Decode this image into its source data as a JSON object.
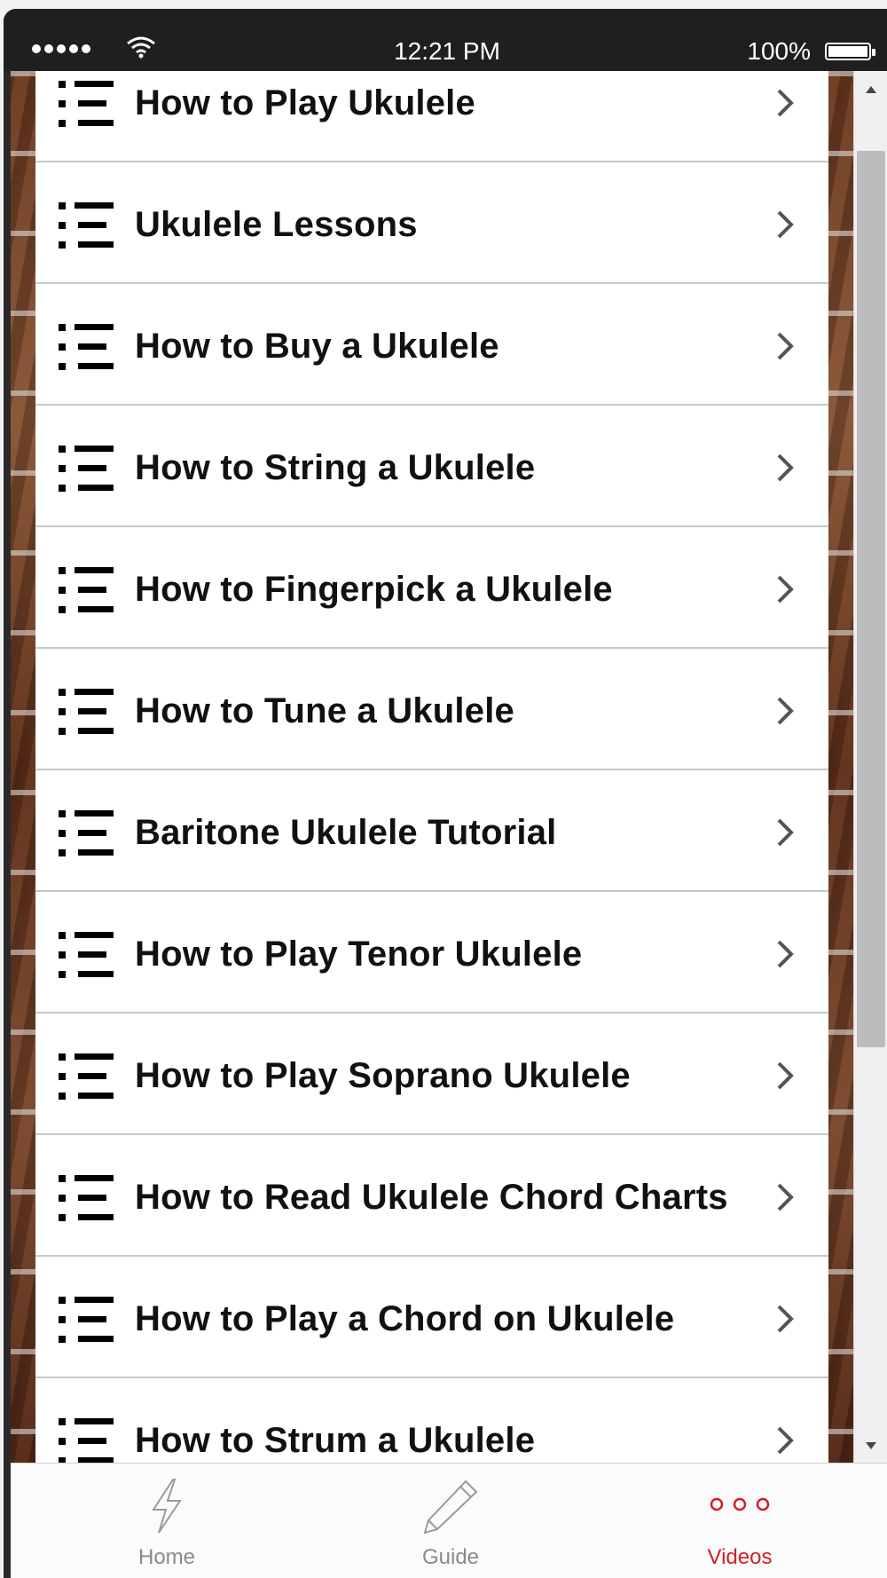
{
  "status_bar": {
    "time": "12:21 PM",
    "battery": "100%"
  },
  "list": {
    "items": [
      {
        "label": "How to Play Ukulele",
        "icon": "list-icon"
      },
      {
        "label": "Ukulele Lessons",
        "icon": "list-icon"
      },
      {
        "label": "How to Buy a Ukulele",
        "icon": "list-icon"
      },
      {
        "label": "How to String a Ukulele",
        "icon": "list-icon"
      },
      {
        "label": "How to Fingerpick a Ukulele",
        "icon": "list-icon"
      },
      {
        "label": "How to Tune a Ukulele",
        "icon": "list-icon"
      },
      {
        "label": "Baritone Ukulele Tutorial",
        "icon": "list-icon"
      },
      {
        "label": "How to Play Tenor Ukulele",
        "icon": "list-icon"
      },
      {
        "label": "How to Play Soprano Ukulele",
        "icon": "list-icon"
      },
      {
        "label": "How to Read Ukulele Chord Charts",
        "icon": "list-icon"
      },
      {
        "label": "How to Play a Chord on Ukulele",
        "icon": "list-icon"
      },
      {
        "label": "How to Strum a Ukulele",
        "icon": "list-icon"
      }
    ]
  },
  "tabbar": {
    "tabs": [
      {
        "label": "Home",
        "icon": "lightning-icon",
        "active": false
      },
      {
        "label": "Guide",
        "icon": "pencil-icon",
        "active": false
      },
      {
        "label": "Videos",
        "icon": "more-dots-icon",
        "active": true
      }
    ],
    "active_color": "#d0202a",
    "inactive_color": "#8a8a8a"
  }
}
